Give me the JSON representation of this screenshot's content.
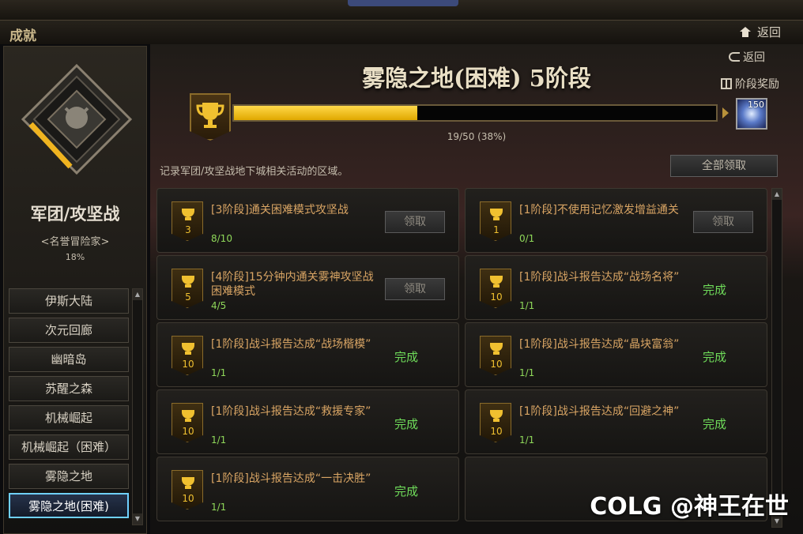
{
  "header": {
    "title": "成就",
    "back_label": "返回"
  },
  "left": {
    "guild_name": "军团/攻坚战",
    "rank": "<名誉冒险家>",
    "percent": "18%",
    "nav": [
      "伊斯大陆",
      "次元回廊",
      "幽暗岛",
      "苏醒之森",
      "机械崛起",
      "机械崛起（困难）",
      "雾隐之地",
      "雾隐之地(困难)"
    ],
    "active_index": 7
  },
  "main": {
    "title": "雾隐之地(困难) 5阶段",
    "back_label": "返回",
    "stage_reward_label": "阶段奖励",
    "progress_text": "19/50 (38%)",
    "progress_fraction": 0.38,
    "reward_count": "150",
    "description": "记录军团/攻坚战地下城相关活动的区域。",
    "claim_all_label": "全部领取"
  },
  "cards": [
    {
      "stage": "3",
      "title": "[3阶段]通关困难模式攻坚战",
      "progress": "8/10",
      "status": "button",
      "status_label": "领取"
    },
    {
      "stage": "1",
      "title": "[1阶段]不使用记忆激发增益通关",
      "progress": "0/1",
      "status": "button",
      "status_label": "领取"
    },
    {
      "stage": "5",
      "title": "[4阶段]15分钟内通关雾神攻坚战困难模式",
      "progress": "4/5",
      "status": "button",
      "status_label": "领取"
    },
    {
      "stage": "10",
      "title": "[1阶段]战斗报告达成“战场名将”",
      "progress": "1/1",
      "status": "done",
      "status_label": "完成"
    },
    {
      "stage": "10",
      "title": "[1阶段]战斗报告达成“战场楷模”",
      "progress": "1/1",
      "status": "done",
      "status_label": "完成"
    },
    {
      "stage": "10",
      "title": "[1阶段]战斗报告达成“晶块富翁”",
      "progress": "1/1",
      "status": "done",
      "status_label": "完成"
    },
    {
      "stage": "10",
      "title": "[1阶段]战斗报告达成“救援专家”",
      "progress": "1/1",
      "status": "done",
      "status_label": "完成"
    },
    {
      "stage": "10",
      "title": "[1阶段]战斗报告达成“回避之神”",
      "progress": "1/1",
      "status": "done",
      "status_label": "完成"
    },
    {
      "stage": "10",
      "title": "[1阶段]战斗报告达成“一击决胜”",
      "progress": "1/1",
      "status": "done",
      "status_label": "完成"
    }
  ],
  "watermark": "COLG @神王在世"
}
